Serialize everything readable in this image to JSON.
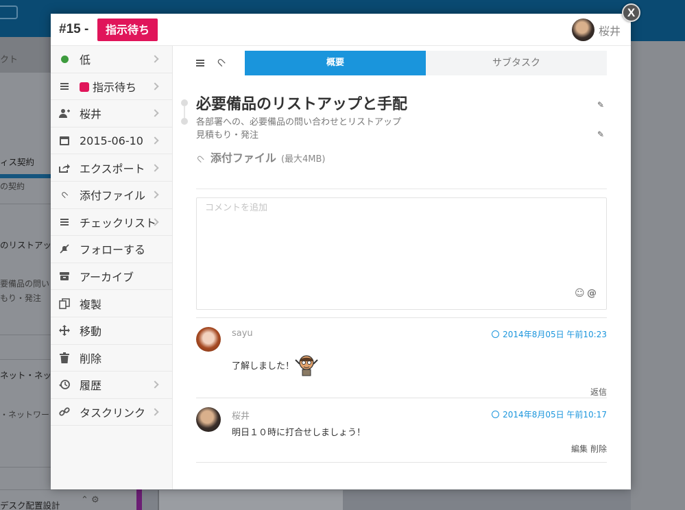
{
  "background": {
    "side_header": "クト",
    "items": [
      {
        "title": "ィス契約",
        "sub": "の契約"
      },
      {
        "title": "のリストアッ",
        "sub": ""
      },
      {
        "title": "",
        "sub": "要備品の問い"
      },
      {
        "title": "",
        "sub": "もり・発注"
      },
      {
        "title": "ネット・ネッ",
        "sub": ""
      },
      {
        "title": "",
        "sub": "・ネットワー"
      },
      {
        "title": "デスク配置設計",
        "sub": ""
      }
    ]
  },
  "header": {
    "task_number": "#15 -",
    "status": "指示待ち",
    "user": "桜井",
    "close_label": "X"
  },
  "sidebar": {
    "items": [
      {
        "key": "priority",
        "label": "低",
        "icon": "green-dot-icon",
        "chevron": true
      },
      {
        "key": "status",
        "label": "指示待ち",
        "icon": "list-icon",
        "chevron": true
      },
      {
        "key": "assignee",
        "label": "桜井",
        "icon": "add-user-icon",
        "chevron": true
      },
      {
        "key": "due-date",
        "label": "2015-06-10",
        "icon": "calendar-icon",
        "chevron": true
      },
      {
        "key": "export",
        "label": "エクスポート",
        "icon": "export-icon",
        "chevron": true
      },
      {
        "key": "attachment",
        "label": "添付ファイル",
        "icon": "paperclip-icon",
        "chevron": true
      },
      {
        "key": "checklist",
        "label": "チェックリスト",
        "icon": "list-icon",
        "chevron": true
      },
      {
        "key": "follow",
        "label": "フォローする",
        "icon": "unfollow-icon",
        "chevron": false
      },
      {
        "key": "archive",
        "label": "アーカイブ",
        "icon": "archive-icon",
        "chevron": false
      },
      {
        "key": "duplicate",
        "label": "複製",
        "icon": "copy-icon",
        "chevron": false
      },
      {
        "key": "move",
        "label": "移動",
        "icon": "move-icon",
        "chevron": false
      },
      {
        "key": "delete",
        "label": "削除",
        "icon": "trash-icon",
        "chevron": false
      },
      {
        "key": "history",
        "label": "履歴",
        "icon": "history-icon",
        "chevron": true
      },
      {
        "key": "task-link",
        "label": "タスクリンク",
        "icon": "link-icon",
        "chevron": true
      }
    ]
  },
  "tabs": {
    "overview": "概要",
    "subtask": "サブタスク",
    "active": "overview"
  },
  "task": {
    "title": "必要備品のリストアップと手配",
    "desc_line1": "各部署への、必要備品の問い合わせとリストアップ",
    "desc_line2": "見積もり・発注"
  },
  "attachment": {
    "title": "添付ファイル",
    "max_size": "(最大4MB)"
  },
  "comment_input": {
    "placeholder": "コメントを追加",
    "value": ""
  },
  "comments": [
    {
      "author": "sayu",
      "timestamp": "2014年8月05日 午前10:23",
      "text": "了解しました！",
      "has_sticker": true,
      "actions": [
        "返信"
      ]
    },
    {
      "author": "桜井",
      "timestamp": "2014年8月05日 午前10:17",
      "text": "明日１０時に打合せしましょう！",
      "has_sticker": false,
      "actions": [
        "編集",
        "削除"
      ]
    }
  ],
  "colors": {
    "accent": "#1a95dc",
    "status_pink": "#e0155a",
    "priority_green": "#3e9b3e"
  }
}
